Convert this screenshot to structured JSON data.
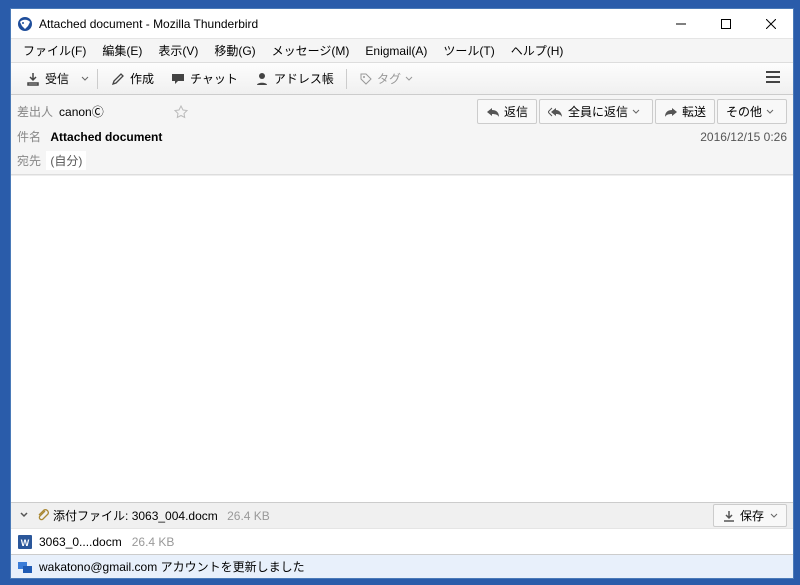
{
  "window": {
    "title": "Attached document - Mozilla Thunderbird"
  },
  "menus": {
    "file": "ファイル(F)",
    "edit": "編集(E)",
    "view": "表示(V)",
    "go": "移動(G)",
    "message": "メッセージ(M)",
    "enigmail": "Enigmail(A)",
    "tools": "ツール(T)",
    "help": "ヘルプ(H)"
  },
  "toolbar": {
    "receive": "受信",
    "compose": "作成",
    "chat": "チャット",
    "addressbook": "アドレス帳",
    "tag": "タグ"
  },
  "email": {
    "sender_label": "差出人",
    "sender": "canonⒸ",
    "subject_label": "件名",
    "subject": "Attached document",
    "date": "2016/12/15 0:26",
    "to_label": "宛先",
    "to_value": "(自分)"
  },
  "actions": {
    "reply": "返信",
    "reply_all": "全員に返信",
    "forward": "転送",
    "other": "その他"
  },
  "attachment": {
    "label": "添付ファイル:",
    "filename": "3063_004.docm",
    "size": "26.4 KB",
    "save": "保存",
    "row_filename": "3063_0....docm",
    "row_size": "26.4 KB"
  },
  "status": {
    "text": "wakatono@gmail.com アカウントを更新しました"
  }
}
